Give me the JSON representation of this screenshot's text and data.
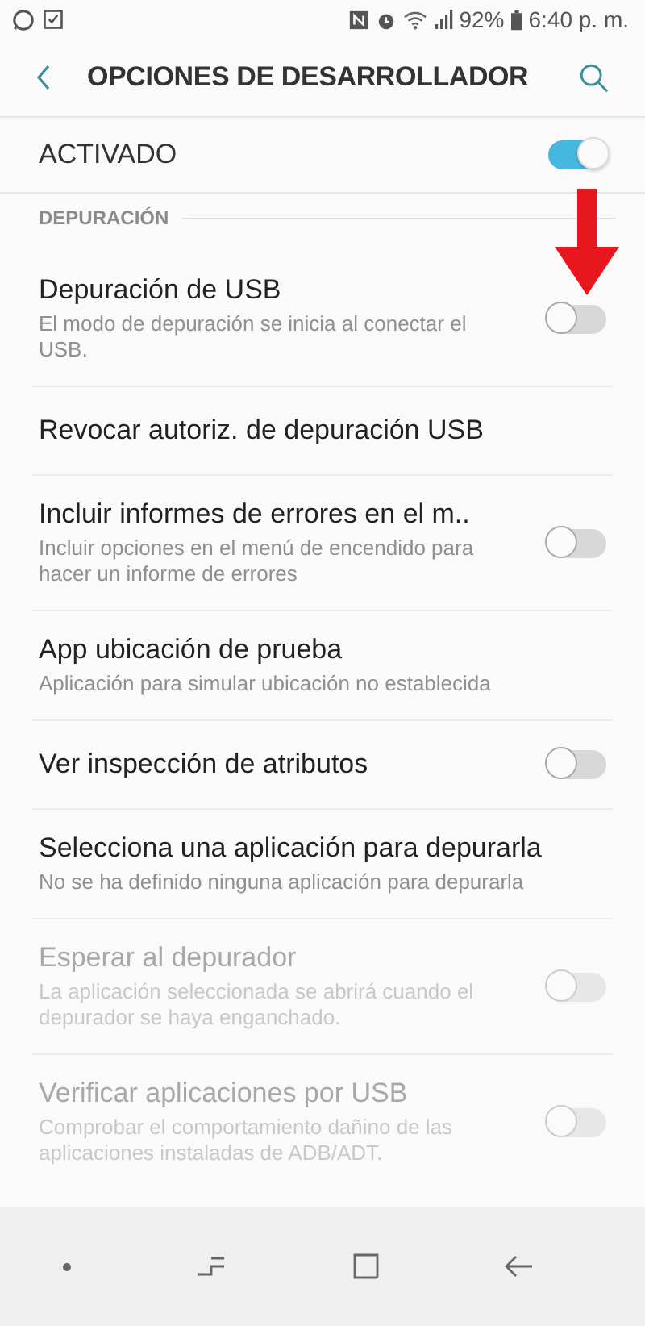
{
  "status_bar": {
    "battery": "92%",
    "time": "6:40 p. m."
  },
  "header": {
    "title": "OPCIONES DE DESARROLLADOR"
  },
  "master_switch": {
    "label": "ACTIVADO",
    "on": true
  },
  "section": {
    "title": "DEPURACIÓN"
  },
  "items": [
    {
      "kind": "switch",
      "title": "Depuración de USB",
      "subtitle": "El modo de depuración se inicia al conectar el USB.",
      "on": false,
      "disabled": false
    },
    {
      "kind": "plain",
      "title": "Revocar autoriz. de depuración USB",
      "disabled": false
    },
    {
      "kind": "switch",
      "title": "Incluir informes de errores en el m..",
      "subtitle": "Incluir opciones en el menú de encendido para hacer un informe de errores",
      "on": false,
      "disabled": false
    },
    {
      "kind": "plain",
      "title": "App ubicación de prueba",
      "subtitle": "Aplicación para simular ubicación no establecida",
      "disabled": false
    },
    {
      "kind": "switch",
      "title": "Ver inspección de atributos",
      "on": false,
      "disabled": false
    },
    {
      "kind": "plain",
      "title": "Selecciona una aplicación para depurarla",
      "subtitle": "No se ha definido ninguna aplicación para depurarla",
      "disabled": false
    },
    {
      "kind": "switch",
      "title": "Esperar al depurador",
      "subtitle": "La aplicación seleccionada se abrirá cuando el depurador se haya enganchado.",
      "on": false,
      "disabled": true
    },
    {
      "kind": "switch",
      "title": "Verificar aplicaciones por USB",
      "subtitle": "Comprobar el comportamiento dañino de las aplicaciones instaladas de ADB/ADT.",
      "on": false,
      "disabled": true
    }
  ]
}
